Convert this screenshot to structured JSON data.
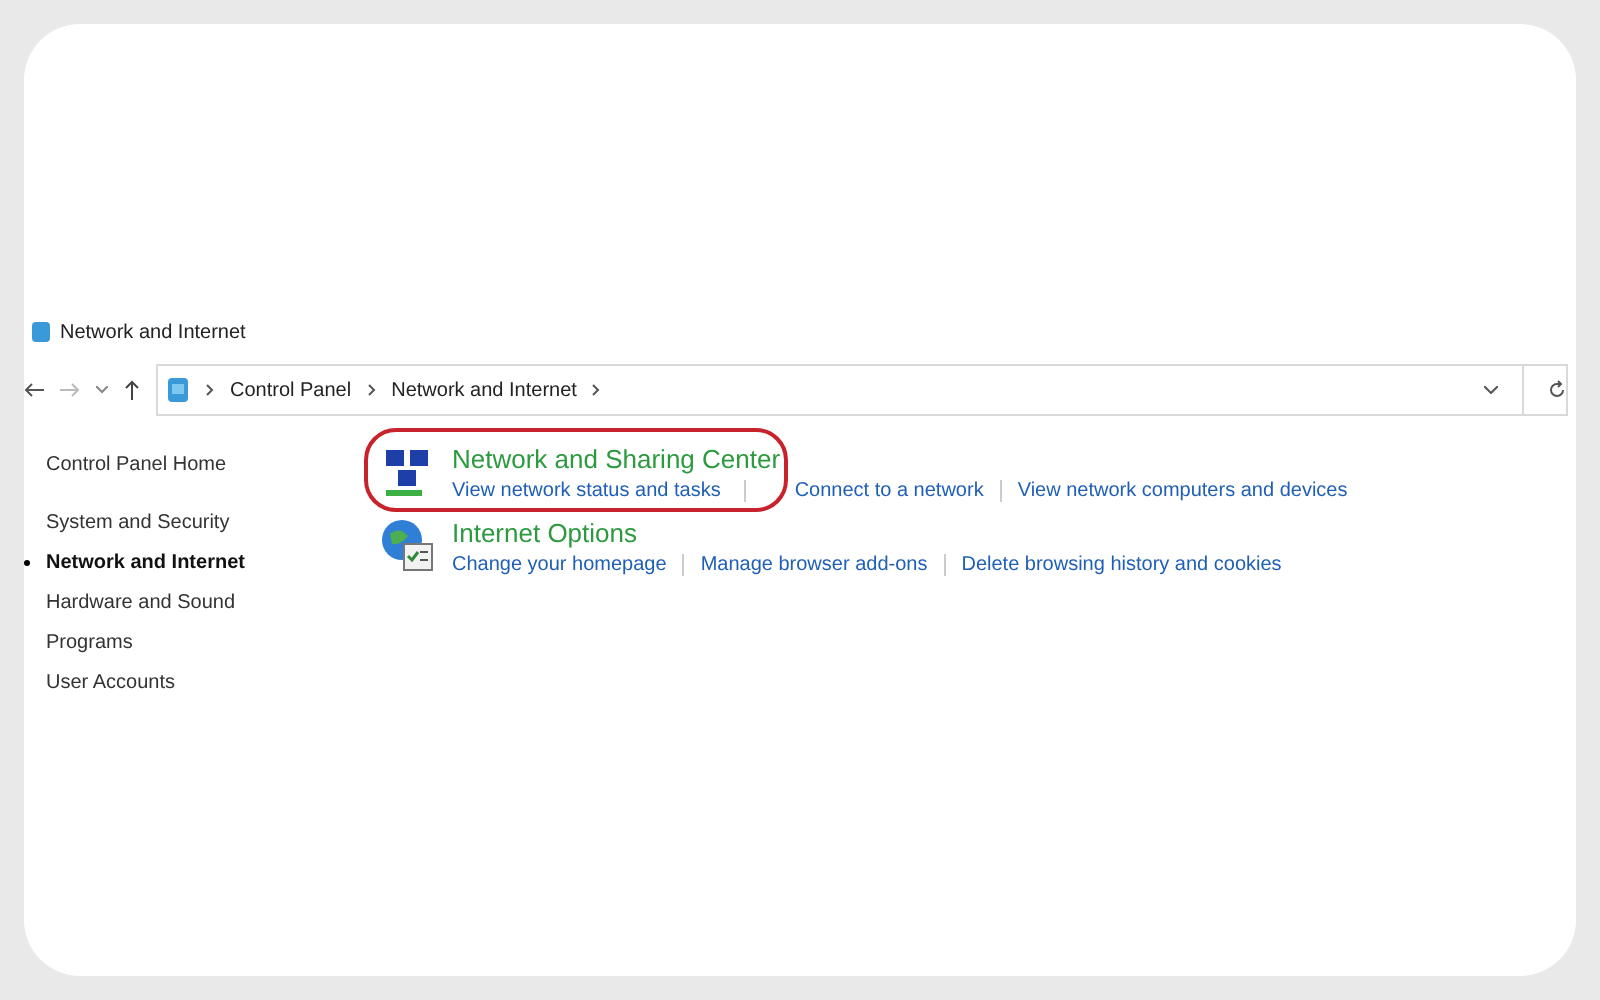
{
  "window": {
    "title": "Network and Internet"
  },
  "address_bar": {
    "crumbs": [
      "Control Panel",
      "Network and Internet"
    ]
  },
  "sidebar": {
    "items": [
      {
        "label": "Control Panel Home",
        "selected": false
      },
      {
        "label": "System and Security",
        "selected": false
      },
      {
        "label": "Network and Internet",
        "selected": true
      },
      {
        "label": "Hardware and Sound",
        "selected": false
      },
      {
        "label": "Programs",
        "selected": false
      },
      {
        "label": "User Accounts",
        "selected": false
      }
    ]
  },
  "categories": [
    {
      "kind": "network",
      "title": "Network and Sharing Center",
      "circled": true,
      "links": [
        "View network status and tasks",
        "Connect to a network",
        "View network computers and devices"
      ]
    },
    {
      "kind": "internet",
      "title": "Internet Options",
      "links": [
        "Change your homepage",
        "Manage browser add-ons",
        "Delete browsing history and cookies"
      ]
    }
  ]
}
